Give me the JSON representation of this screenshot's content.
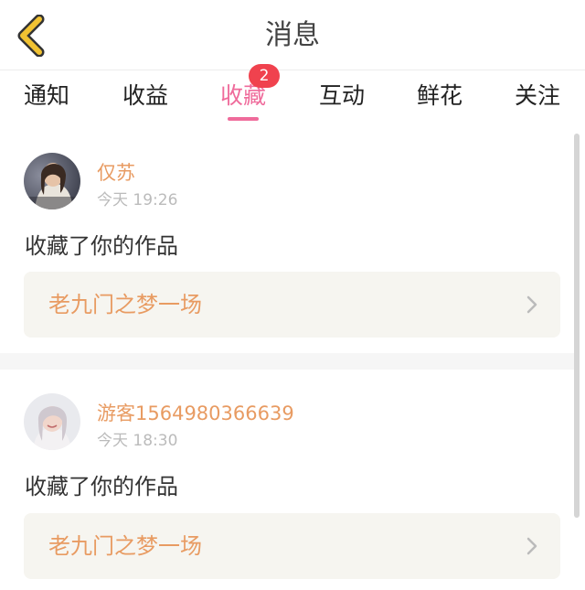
{
  "header": {
    "title": "消息",
    "back_icon": "chevron-left-icon"
  },
  "tabs": [
    {
      "label": "通知"
    },
    {
      "label": "收益"
    },
    {
      "label": "收藏",
      "badge": "2",
      "active": true
    },
    {
      "label": "互动"
    },
    {
      "label": "鲜花"
    },
    {
      "label": "关注"
    }
  ],
  "messages": [
    {
      "user": "仅苏",
      "time": "今天 19:26",
      "action": "收藏了你的作品",
      "work_title": "老九门之梦一场"
    },
    {
      "user": "游客1564980366639",
      "time": "今天 18:30",
      "action": "收藏了你的作品",
      "work_title": "老九门之梦一场"
    }
  ],
  "colors": {
    "accent": "#ef6b9b",
    "username": "#e89b62",
    "badge": "#f0424e",
    "back_icon": "#f1c232"
  }
}
